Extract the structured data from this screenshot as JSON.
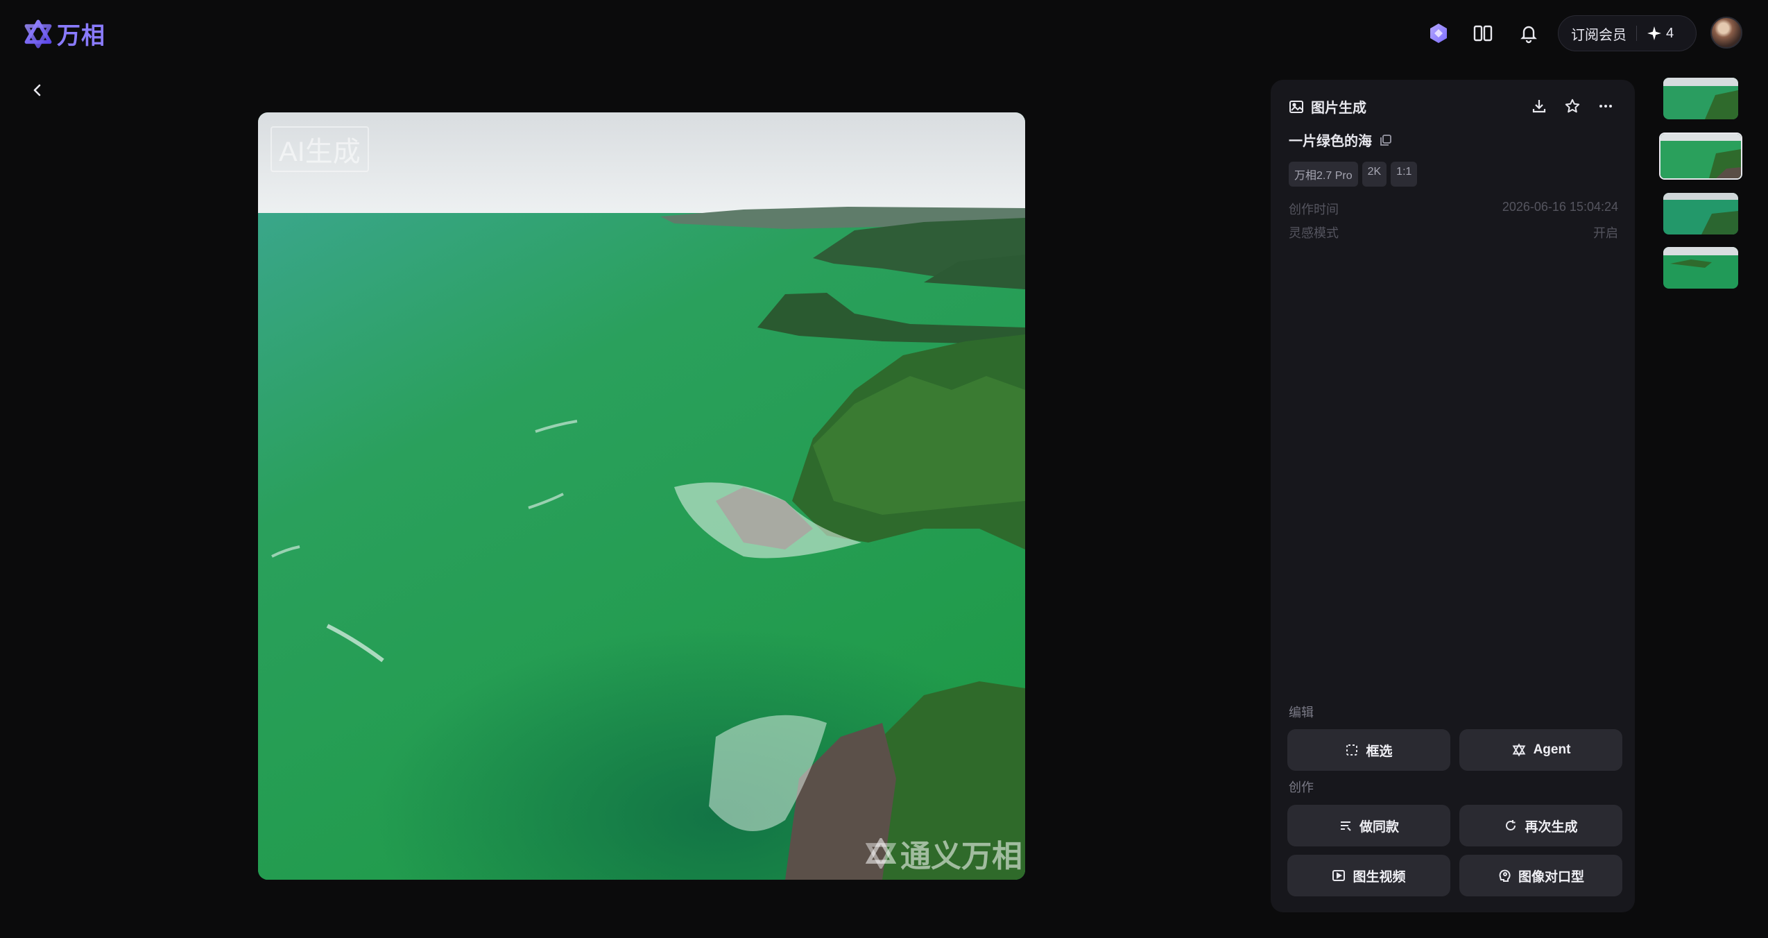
{
  "app": {
    "name": "万相",
    "brand_color": "#8a7bff"
  },
  "header": {
    "subscribe_label": "订阅会员",
    "credits": "4",
    "icons": [
      "magic-icon",
      "layout-icon",
      "bell-icon"
    ]
  },
  "image": {
    "watermark_ai": "AI生成",
    "watermark_brand": "通义万相"
  },
  "panel": {
    "title": "图片生成",
    "prompt": "一片绿色的海",
    "tags": [
      "万相2.7 Pro",
      "2K",
      "1:1"
    ],
    "meta": [
      {
        "label": "创作时间",
        "value": "2026-06-16 15:04:24"
      },
      {
        "label": "灵感模式",
        "value": "开启"
      }
    ],
    "edit_label": "编辑",
    "create_label": "创作",
    "buttons": {
      "select": "框选",
      "agent": "Agent",
      "same_style": "做同款",
      "regenerate": "再次生成",
      "image_to_video": "图生视频",
      "lip_sync": "图像对口型"
    }
  }
}
